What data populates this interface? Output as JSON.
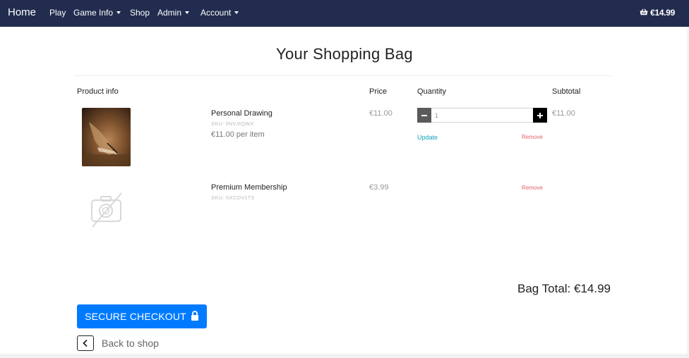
{
  "navbar": {
    "brand": "Home",
    "items": [
      {
        "label": "Play",
        "dropdown": false
      },
      {
        "label": "Game Info",
        "dropdown": true
      },
      {
        "label": "Shop",
        "dropdown": false
      },
      {
        "label": "Admin",
        "dropdown": true
      },
      {
        "label": "Account",
        "dropdown": true
      }
    ],
    "bag_total": "€14.99",
    "bag_icon": "basket-icon"
  },
  "page": {
    "title": "Your Shopping Bag"
  },
  "table": {
    "headers": {
      "product_info": "Product info",
      "price": "Price",
      "quantity": "Quantity",
      "subtotal": "Subtotal"
    },
    "rows": [
      {
        "name": "Personal Drawing",
        "sku": "SKU: 0NVJIQWX",
        "per_item": "€11.00 per item",
        "price": "€11.00",
        "quantity": "1",
        "update_label": "Update",
        "remove_label": "Remove",
        "subtotal": "€11.00",
        "image_icon": "drawing-photo"
      },
      {
        "name": "Premium Membership",
        "sku": "SKU: XXCDV1T3",
        "price": "€3.99",
        "remove_label": "Remove",
        "image_icon": "no-image-icon"
      }
    ]
  },
  "summary": {
    "bag_total": "Bag Total: €14.99",
    "checkout_label": "SECURE CHECKOUT",
    "checkout_icon": "lock-icon",
    "back_label": "Back to shop",
    "back_icon": "chevron-left-icon"
  },
  "colors": {
    "navbar": "#212c4f",
    "primary": "#007bff",
    "info": "#17a2b8",
    "danger": "#e4606d"
  }
}
